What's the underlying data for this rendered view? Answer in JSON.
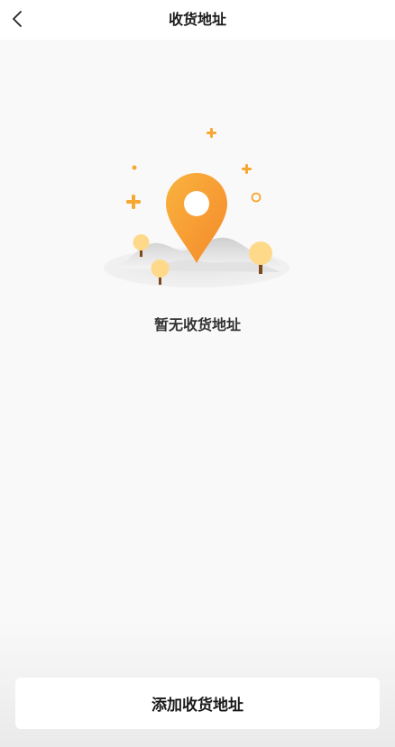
{
  "header": {
    "title": "收货地址"
  },
  "empty_state": {
    "message": "暂无收货地址"
  },
  "footer": {
    "add_button_label": "添加收货地址"
  },
  "colors": {
    "accent_orange": "#F79A2B",
    "accent_orange_light": "#F9B33E",
    "tree_yellow": "#FFD98A",
    "background": "#F9F9F9"
  }
}
